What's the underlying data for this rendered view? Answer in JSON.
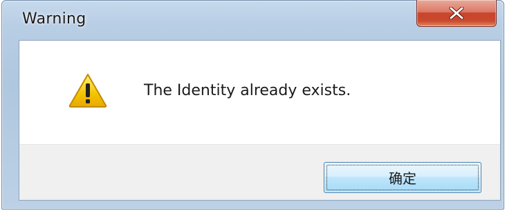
{
  "dialog": {
    "title": "Warning",
    "message": "The Identity already exists.",
    "icon": "warning-icon",
    "ok_label": "确定",
    "close_icon": "close-icon"
  },
  "colors": {
    "frame": "#b8cee5",
    "close_button": "#c8452c",
    "ok_button_border": "#3c7fb1",
    "button_area": "#f0f0f0",
    "warning_yellow": "#f5c400"
  }
}
